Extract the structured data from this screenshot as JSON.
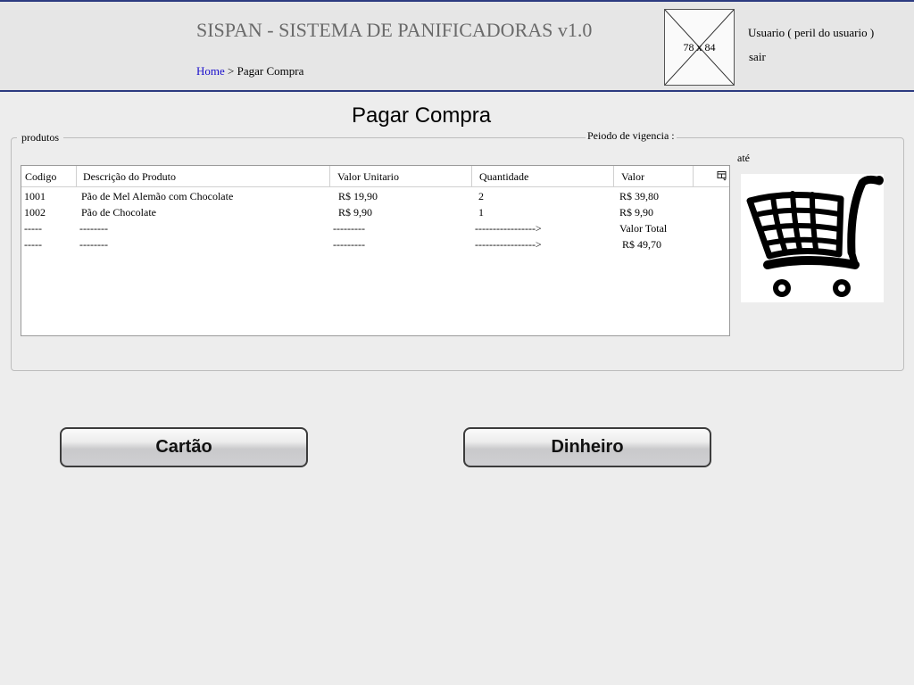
{
  "header": {
    "app_title": "SISPAN - SISTEMA DE PANIFICADORAS v1.0",
    "breadcrumb": {
      "home": "Home",
      "separator": " > ",
      "current": "Pagar Compra"
    },
    "image_placeholder": "78 x 84",
    "user_label": "Usuario ( peril do usuario )",
    "logout": "sair"
  },
  "page_title": "Pagar Compra",
  "form": {
    "legend": "produtos",
    "vigencia_label": "Peiodo de vigencia :",
    "ate_label": "até"
  },
  "table": {
    "columns": [
      "Codigo",
      "Descrição do Produto",
      "Valor Unitario",
      "Quantidade",
      "Valor"
    ],
    "rows": [
      [
        "1001",
        "Pão de Mel Alemão com Chocolate",
        "R$ 19,90",
        "2",
        "R$ 39,80"
      ],
      [
        "1002",
        "Pão de Chocolate",
        "R$ 9,90",
        "1",
        "R$ 9,90"
      ],
      [
        "-----",
        "--------",
        "---------",
        "----------------->",
        "Valor Total"
      ],
      [
        "-----",
        "--------",
        "---------",
        "----------------->",
        " R$ 49,70"
      ]
    ],
    "column_menu_icon": "column-menu-icon"
  },
  "cart_icon": "shopping-cart-icon",
  "buttons": {
    "card": "Cartão",
    "cash": "Dinheiro"
  },
  "colors": {
    "header_border": "#2c3b80",
    "link": "#1a0ecc",
    "header_bg": "#e6e6e6",
    "page_bg": "#ededed"
  }
}
